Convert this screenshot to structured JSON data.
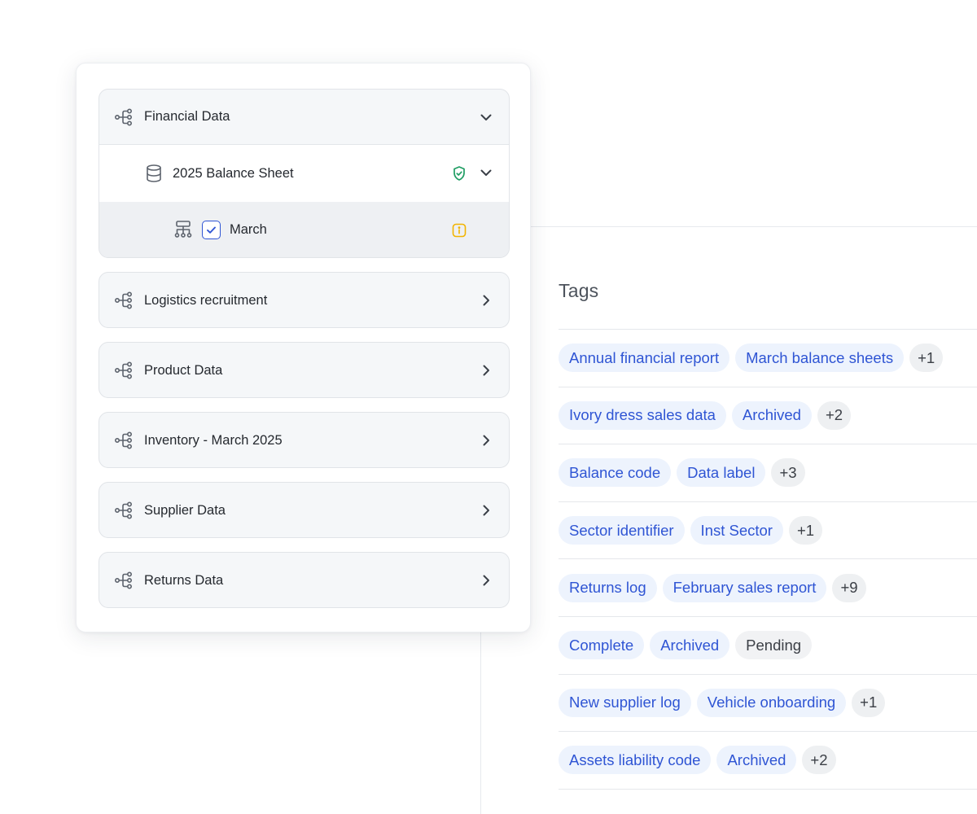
{
  "tree": {
    "groups": [
      {
        "label": "Financial Data",
        "expanded": true,
        "children": [
          {
            "label": "2025 Balance Sheet",
            "status_icon": "shield-check-icon",
            "status_color": "#1f9d63",
            "expanded": true,
            "children": [
              {
                "label": "March",
                "checked": true,
                "status_icon": "info-icon",
                "status_color": "#f2b400"
              }
            ]
          }
        ]
      },
      {
        "label": "Logistics recruitment",
        "expanded": false
      },
      {
        "label": "Product Data",
        "expanded": false
      },
      {
        "label": "Inventory - March 2025",
        "expanded": false
      },
      {
        "label": "Supplier Data",
        "expanded": false
      },
      {
        "label": "Returns Data",
        "expanded": false
      }
    ]
  },
  "tags": {
    "header": "Tags",
    "rows": [
      [
        {
          "text": "Annual financial report",
          "style": "blue"
        },
        {
          "text": "March balance sheets",
          "style": "blue"
        },
        {
          "text": "+1",
          "style": "count"
        }
      ],
      [
        {
          "text": "Ivory dress sales data",
          "style": "blue"
        },
        {
          "text": "Archived",
          "style": "blue"
        },
        {
          "text": "+2",
          "style": "count"
        }
      ],
      [
        {
          "text": "Balance code",
          "style": "blue"
        },
        {
          "text": "Data label",
          "style": "blue"
        },
        {
          "text": "+3",
          "style": "count"
        }
      ],
      [
        {
          "text": "Sector identifier",
          "style": "blue"
        },
        {
          "text": "Inst Sector",
          "style": "blue"
        },
        {
          "text": "+1",
          "style": "count"
        }
      ],
      [
        {
          "text": "Returns log",
          "style": "blue"
        },
        {
          "text": "February sales report",
          "style": "blue"
        },
        {
          "text": "+9",
          "style": "count"
        }
      ],
      [
        {
          "text": "Complete",
          "style": "blue"
        },
        {
          "text": "Archived",
          "style": "blue"
        },
        {
          "text": "Pending",
          "style": "gray"
        }
      ],
      [
        {
          "text": "New supplier log",
          "style": "blue"
        },
        {
          "text": "Vehicle onboarding",
          "style": "blue"
        },
        {
          "text": "+1",
          "style": "count"
        }
      ],
      [
        {
          "text": "Assets liability code",
          "style": "blue"
        },
        {
          "text": "Archived",
          "style": "blue"
        },
        {
          "text": "+2",
          "style": "count"
        }
      ]
    ]
  },
  "colors": {
    "chip_blue_bg": "#edf3fd",
    "chip_blue_text": "#2f55d4",
    "checkbox": "#2f55d4",
    "icon_gray": "#5d636d"
  }
}
